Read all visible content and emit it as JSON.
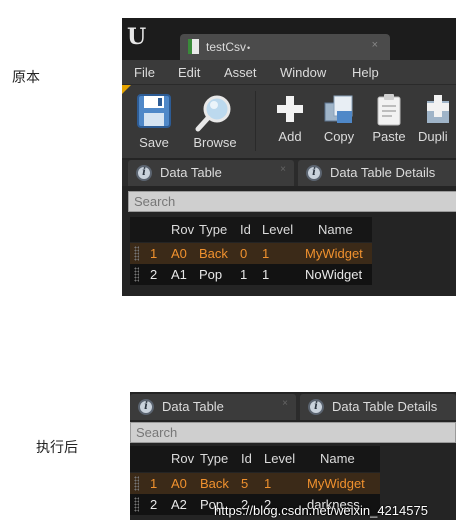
{
  "captions": {
    "before": "原本",
    "after": "执行后"
  },
  "window": {
    "logo": "U",
    "tab": {
      "title": "testCsv",
      "modified_mark": "•",
      "close": "×"
    },
    "menu": [
      "File",
      "Edit",
      "Asset",
      "Window",
      "Help"
    ],
    "toolbar": {
      "save": "Save",
      "browse": "Browse",
      "add": "Add",
      "copy": "Copy",
      "paste": "Paste",
      "duplicate": "Dupli"
    }
  },
  "panel_tabs": {
    "data_table": "Data Table",
    "details": "Data Table Details",
    "close": "×"
  },
  "search": {
    "placeholder": "Search"
  },
  "columns": [
    "Rov",
    "Type",
    "Id",
    "Level",
    "Name"
  ],
  "before": {
    "rows": [
      {
        "num": "1",
        "row": "A0",
        "type": "Back",
        "id": "0",
        "level": "1",
        "name": "MyWidget",
        "selected": true
      },
      {
        "num": "2",
        "row": "A1",
        "type": "Pop",
        "id": "1",
        "level": "1",
        "name": "NoWidget",
        "selected": false
      }
    ]
  },
  "after": {
    "rows": [
      {
        "num": "1",
        "row": "A0",
        "type": "Back",
        "id": "5",
        "level": "1",
        "name": "MyWidget",
        "selected": true
      },
      {
        "num": "2",
        "row": "A2",
        "type": "Pop",
        "id": "2",
        "level": "2",
        "name": "darkness",
        "selected": false
      }
    ]
  },
  "watermark": "https://blog.csdn.net/weixin_4214575",
  "colors": {
    "selected_text": "#f0912e",
    "accent_corner": "#e6a400",
    "background": "#242424"
  },
  "icons": [
    "unreal-logo-icon",
    "document-icon",
    "floppy-disk-icon",
    "magnifier-icon",
    "plus-icon",
    "copy-icon",
    "clipboard-icon",
    "info-icon"
  ]
}
